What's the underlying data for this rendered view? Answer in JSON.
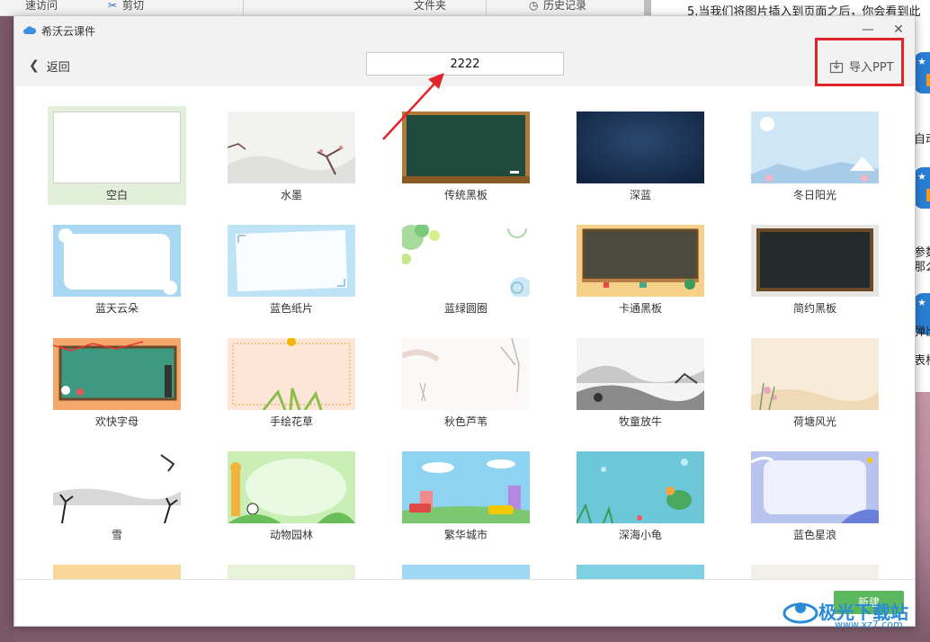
{
  "background_app": {
    "toolbar_items": [
      "速访问",
      "剪切",
      "文件夹",
      "历史记录"
    ],
    "doc_line": "5.当我们将图片插入到页面之后，你会看到此",
    "side_texts": [
      "自动",
      "参数",
      "那么",
      "弹出",
      "表格"
    ]
  },
  "dialog": {
    "title": "希沃云课件",
    "minimize_glyph": "—",
    "close_glyph": "✕",
    "back_label": "返回",
    "title_input_value": "2222",
    "import_label": "导入PPT",
    "new_button_label": "新建"
  },
  "templates": [
    {
      "name": "空白",
      "selected": true
    },
    {
      "name": "水墨"
    },
    {
      "name": "传统黑板"
    },
    {
      "name": "深蓝"
    },
    {
      "name": "冬日阳光"
    },
    {
      "name": "蓝天云朵"
    },
    {
      "name": "蓝色纸片"
    },
    {
      "name": "蓝绿圆圈"
    },
    {
      "name": "卡通黑板"
    },
    {
      "name": "简约黑板"
    },
    {
      "name": "欢快字母"
    },
    {
      "name": "手绘花草"
    },
    {
      "name": "秋色芦苇"
    },
    {
      "name": "牧童放牛"
    },
    {
      "name": "荷塘风光"
    },
    {
      "name": "雪"
    },
    {
      "name": "动物园林"
    },
    {
      "name": "繁华城市"
    },
    {
      "name": "深海小龟"
    },
    {
      "name": "蓝色星浪"
    }
  ],
  "watermark": {
    "text": "极光下载站",
    "url": "www.xz7.com"
  },
  "colors": {
    "accent_red": "#e0242a",
    "new_button_green": "#5cb85c",
    "selected_tile": "#e2f0d9"
  }
}
